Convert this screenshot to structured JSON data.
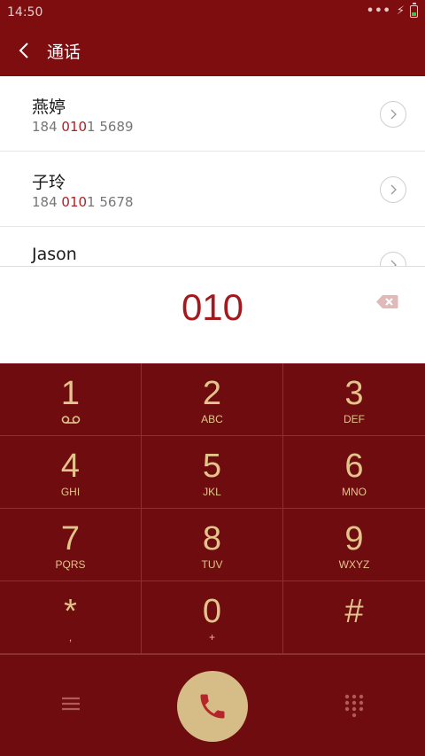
{
  "status_bar": {
    "time": "14:50",
    "dots": "•••",
    "battery_level": "charging"
  },
  "header": {
    "title": "通话",
    "back_icon": "chevron-left-icon"
  },
  "results": [
    {
      "name": "燕婷",
      "num_prefix": "184 ",
      "num_match": "010",
      "num_suffix": "1 5689"
    },
    {
      "name": "子玲",
      "num_prefix": "184 ",
      "num_match": "010",
      "num_suffix": "1 5678"
    },
    {
      "name": "Jason",
      "num_prefix": "",
      "num_match": "",
      "num_suffix": ""
    }
  ],
  "dial_input": {
    "value": "010",
    "backspace_icon": "backspace-icon"
  },
  "keypad": [
    {
      "digit": "1",
      "letters": ""
    },
    {
      "digit": "2",
      "letters": "ABC"
    },
    {
      "digit": "3",
      "letters": "DEF"
    },
    {
      "digit": "4",
      "letters": "GHI"
    },
    {
      "digit": "5",
      "letters": "JKL"
    },
    {
      "digit": "6",
      "letters": "MNO"
    },
    {
      "digit": "7",
      "letters": "PQRS"
    },
    {
      "digit": "8",
      "letters": "TUV"
    },
    {
      "digit": "9",
      "letters": "WXYZ"
    },
    {
      "digit": "*",
      "letters": ","
    },
    {
      "digit": "0",
      "letters": "+"
    },
    {
      "digit": "#",
      "letters": ""
    }
  ],
  "bottom_bar": {
    "menu_icon": "menu-icon",
    "call_icon": "phone-icon",
    "keypad_icon": "keypad-icon"
  },
  "colors": {
    "primary": "#7e0d10",
    "keypad_bg": "#6e0c0f",
    "accent_gold": "#e3c48a",
    "highlight": "#b01e22"
  }
}
